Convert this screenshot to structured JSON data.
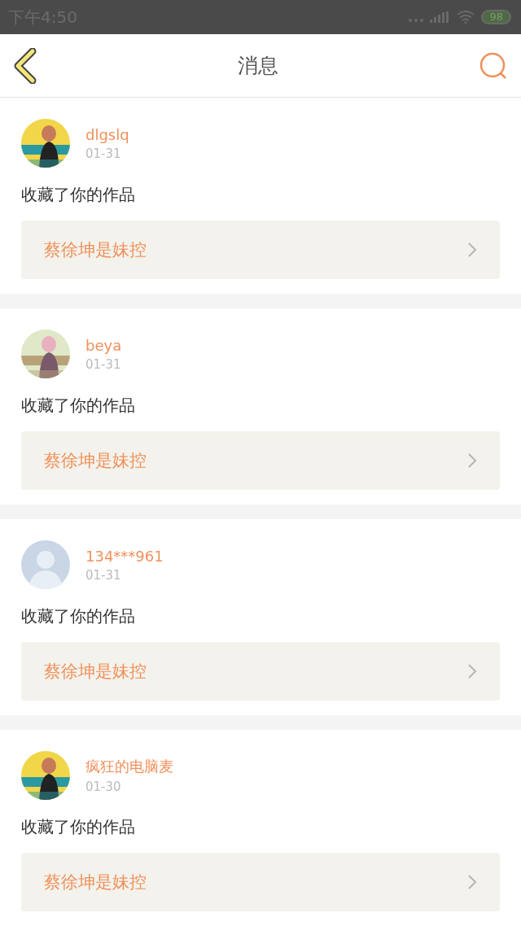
{
  "status_bar": {
    "time": "下午4:50",
    "battery": "98"
  },
  "header": {
    "title": "消息"
  },
  "messages": [
    {
      "user": "dlgslq",
      "date": "01-31",
      "action": "收藏了你的作品",
      "work": "蔡徐坤是妹控"
    },
    {
      "user": "beya",
      "date": "01-31",
      "action": "收藏了你的作品",
      "work": "蔡徐坤是妹控"
    },
    {
      "user": "134***961",
      "date": "01-31",
      "avatar": {
        "kind": "default"
      },
      "action": "收藏了你的作品",
      "work": "蔡徐坤是妹控"
    },
    {
      "user": "疯狂的电脑麦",
      "date": "01-30",
      "action": "收藏了你的作品",
      "work": "蔡徐坤是妹控"
    }
  ]
}
